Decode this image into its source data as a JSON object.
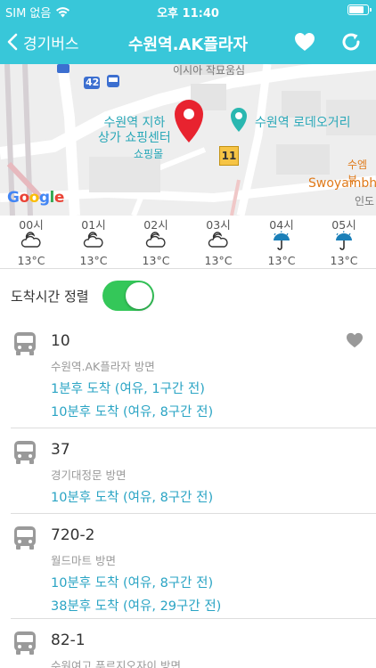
{
  "status_bar": {
    "carrier": "SIM 없음",
    "time": "오후 11:40",
    "battery_level": 0.85
  },
  "nav": {
    "back_label": "경기버스",
    "title": "수원역.AK플라자"
  },
  "map": {
    "labels": {
      "underground_mall_line1": "수원역 지하",
      "underground_mall_line2": "상가 쇼핑센터",
      "shopping_mall": "쇼핑몰",
      "rodeo_street": "수원역 로데오거리",
      "top_building": "이시아 작묘움심",
      "swoyambhu_ko": "수엠부",
      "swoyambhu_en": "Swoyambh",
      "india": "인도",
      "route_42": "42",
      "route_11": "11",
      "google": "Google"
    }
  },
  "weather": {
    "hours": [
      {
        "time": "00시",
        "icon": "partly-cloudy-night-icon",
        "temp": "13°C"
      },
      {
        "time": "01시",
        "icon": "partly-cloudy-night-icon",
        "temp": "13°C"
      },
      {
        "time": "02시",
        "icon": "partly-cloudy-night-icon",
        "temp": "13°C"
      },
      {
        "time": "03시",
        "icon": "partly-cloudy-night-icon",
        "temp": "13°C"
      },
      {
        "time": "04시",
        "icon": "umbrella-rain-icon",
        "temp": "13°C"
      },
      {
        "time": "05시",
        "icon": "umbrella-rain-icon",
        "temp": "13°C"
      }
    ]
  },
  "sort": {
    "label": "도착시간 정렬",
    "enabled": true
  },
  "buses": [
    {
      "number": "10",
      "direction": "수원역.AK플라자 방면",
      "favorite": true,
      "arrivals": [
        "1분후 도착 (여유, 1구간 전)",
        "10분후 도착 (여유, 8구간 전)"
      ]
    },
    {
      "number": "37",
      "direction": "경기대정문 방면",
      "favorite": false,
      "arrivals": [
        "10분후 도착 (여유, 8구간 전)"
      ]
    },
    {
      "number": "720-2",
      "direction": "월드마트 방면",
      "favorite": false,
      "arrivals": [
        "10분후 도착 (여유, 8구간 전)",
        "38분후 도착 (여유, 29구간 전)"
      ]
    },
    {
      "number": "82-1",
      "direction": "수원여고 푸르지오자이 방면",
      "favorite": false,
      "arrivals": []
    }
  ],
  "colors": {
    "header": "#38c7d9",
    "arrival_text": "#2aa4c4",
    "toggle_on": "#34c759",
    "marker": "#e8232f",
    "route_badge": "#f6c445"
  }
}
